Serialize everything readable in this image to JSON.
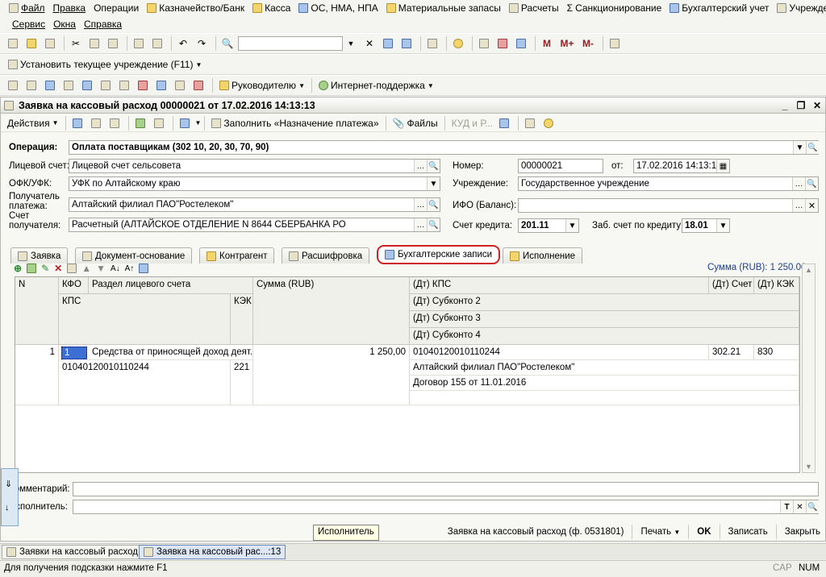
{
  "menu": {
    "row1": [
      "Файл",
      "Правка",
      "Операции",
      "Казначейство/Банк",
      "Касса",
      "ОС, НМА, НПА",
      "Материальные запасы",
      "Расчеты",
      "Санкционирование",
      "Бухгалтерский учет",
      "Учреждение"
    ],
    "row2": [
      "Сервис",
      "Окна",
      "Справка"
    ]
  },
  "toolbar3": {
    "set_institution": "Установить текущее учреждение (F11)"
  },
  "toolbar4": {
    "manager": "Руководителю",
    "internet": "Интернет-поддержка"
  },
  "toolbar2": {
    "m": "M",
    "mplus": "M+",
    "mminus": "M-"
  },
  "window": {
    "title": "Заявка на кассовый расход 00000021 от 17.02.2016 14:13:13"
  },
  "actions": {
    "actions": "Действия",
    "fill": "Заполнить «Назначение платежа»",
    "files": "Файлы",
    "kud": "КУД и Р..."
  },
  "form": {
    "operation_label": "Операция:",
    "operation_value": "Оплата поставщикам (302 10, 20, 30, 70, 90)",
    "account_label": "Лицевой счет:",
    "account_value": "Лицевой счет сельсовета",
    "number_label": "Номер:",
    "number_value": "00000021",
    "from_label": "от:",
    "date_value": "17.02.2016 14:13:13",
    "ofk_label": "ОФК/УФК:",
    "ofk_value": "УФК по Алтайскому краю",
    "institution_label": "Учреждение:",
    "institution_value": "Государственное учреждение",
    "payee_label_1": "Получатель",
    "payee_label_2": "платежа:",
    "payee_value": "Алтайский филиал ПАО\"Ростелеком\"",
    "ifo_label": "ИФО (Баланс):",
    "ifo_value": "",
    "payee_acc_label_1": "Счет",
    "payee_acc_label_2": "получателя:",
    "payee_acc_value": "Расчетный (АЛТАЙСКОЕ ОТДЕЛЕНИЕ N 8644 СБЕРБАНКА РО",
    "credit_acc_label": "Счет кредита:",
    "credit_acc_value": "201.11",
    "zab_label": "Заб. счет по кредиту:",
    "zab_value": "18.01"
  },
  "tabs": [
    "Заявка",
    "Документ-основание",
    "Контрагент",
    "Расшифровка",
    "Бухгалтерские записи",
    "Исполнение"
  ],
  "grid": {
    "sum_caption": "Сумма (RUB): 1 250.00",
    "headers": {
      "n": "N",
      "kfo": "КФО",
      "section": "Раздел лицевого счета",
      "sum": "Сумма (RUB)",
      "dt_kps": "(Дт) КПС",
      "dt_acc": "(Дт) Счет",
      "dt_kek": "(Дт) КЭК",
      "kps": "КПС",
      "kek": "КЭК",
      "sub2": "(Дт) Субконто 2",
      "sub3": "(Дт) Субконто 3",
      "sub4": "(Дт) Субконто 4"
    },
    "row": {
      "n": "1",
      "kfo": "1",
      "section": "Средства от приносящей доход деят...",
      "sum": "1 250,00",
      "dt_kps": "01040120010110244",
      "dt_acc": "302.21",
      "dt_kek": "830",
      "kps": "01040120010110244",
      "kek": "221",
      "sub2": "Алтайский филиал ПАО\"Ростелеком\"",
      "sub3": "Договор 155 от 11.01.2016",
      "sub4": ""
    }
  },
  "comment_label": "Комментарий:",
  "executor_label": "Исполнитель:",
  "tooltip": "Исполнитель",
  "bottom": {
    "doc": "Заявка на кассовый расход (ф. 0531801)",
    "print": "Печать",
    "ok": "OK",
    "save": "Записать",
    "close": "Закрыть"
  },
  "taskbar": [
    "Заявки на кассовый расход",
    "Заявка на кассовый рас...:13"
  ],
  "status": {
    "hint": "Для получения подсказки нажмите F1",
    "cap": "CAP",
    "num": "NUM"
  },
  "colors": {
    "accent_red": "#d02020",
    "selected_cell": "#3c6fd1"
  }
}
